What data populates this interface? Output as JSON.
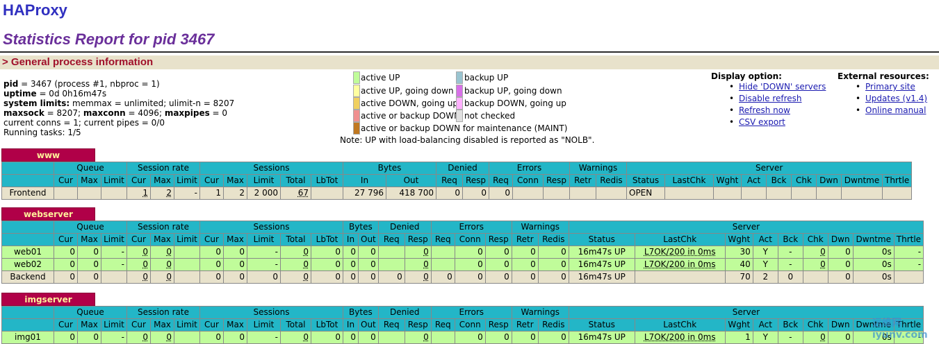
{
  "title": "HAProxy",
  "subtitle": "Statistics Report for pid 3467",
  "section": "> General process information",
  "info": {
    "pid_label": "pid",
    "pid_value": " = 3467 (process #1, nbproc = 1)",
    "uptime_label": "uptime",
    "uptime_value": " = 0d 0h16m47s",
    "limits_label": "system limits:",
    "limits_value": " memmax = unlimited; ulimit-n = 8207",
    "maxsock_label": "maxsock",
    "maxsock_value": " = 8207; ",
    "maxconn_label": "maxconn",
    "maxconn_value": " = 4096; ",
    "maxpipes_label": "maxpipes",
    "maxpipes_value": " = 0",
    "conns": "current conns = 1; current pipes = 0/0",
    "tasks": "Running tasks: 1/5"
  },
  "legend": {
    "active_up": "active UP",
    "active_up_going_down": "active UP, going down",
    "active_down_going_up": "active DOWN, going up",
    "active_or_backup_down": "active or backup DOWN",
    "maint": "active or backup DOWN for maintenance (MAINT)",
    "backup_up": "backup UP",
    "backup_up_going_down": "backup UP, going down",
    "backup_down_going_up": "backup DOWN, going up",
    "not_checked": "not checked",
    "colors": {
      "active_up": "#c0fc9a",
      "active_up_going_down": "#ffffa0",
      "active_down_going_up": "#f0d060",
      "active_or_backup_down": "#f09090",
      "maint": "#c07820",
      "backup_up": "#99c4d0",
      "backup_up_going_down": "#d870e8",
      "backup_down_going_up": "#ffb0ff",
      "not_checked": "#e0e0e0"
    }
  },
  "note": "Note: UP with load-balancing disabled is reported as \"NOLB\".",
  "display": {
    "heading": "Display option:",
    "items": [
      "Hide 'DOWN' servers",
      "Disable refresh",
      "Refresh now",
      "CSV export"
    ]
  },
  "external": {
    "heading": "External resources:",
    "items": [
      "Primary site",
      "Updates (v1.4)",
      "Online manual"
    ]
  },
  "groups": [
    "Queue",
    "Session rate",
    "Sessions",
    "Bytes",
    "Denied",
    "Errors",
    "Warnings",
    "Server"
  ],
  "cols": {
    "queue": [
      "Cur",
      "Max",
      "Limit"
    ],
    "rate": [
      "Cur",
      "Max",
      "Limit"
    ],
    "sessions": [
      "Cur",
      "Max",
      "Limit",
      "Total",
      "LbTot"
    ],
    "bytes": [
      "In",
      "Out"
    ],
    "denied": [
      "Req",
      "Resp"
    ],
    "errors": [
      "Req",
      "Conn",
      "Resp"
    ],
    "warnings": [
      "Retr",
      "Redis"
    ],
    "server": [
      "Status",
      "LastChk",
      "Wght",
      "Act",
      "Bck",
      "Chk",
      "Dwn",
      "Dwntme",
      "Thrtle"
    ]
  },
  "proxies": [
    {
      "name": "www",
      "rows": [
        {
          "kind": "fe",
          "cells": [
            "Frontend",
            "",
            "",
            "",
            "1",
            "2",
            "-",
            "1",
            "2",
            "2 000",
            "67",
            "",
            "27 796",
            "418 700",
            "0",
            "0",
            "0",
            "",
            "",
            "",
            "",
            "OPEN",
            "",
            "",
            "",
            "",
            "",
            "",
            "",
            ""
          ]
        }
      ]
    },
    {
      "name": "webserver",
      "rows": [
        {
          "kind": "sv",
          "cells": [
            "web01",
            "0",
            "0",
            "-",
            "0",
            "0",
            "",
            "0",
            "0",
            "-",
            "0",
            "0",
            "0",
            "0",
            "",
            "0",
            "",
            "0",
            "0",
            "0",
            "0",
            "16m47s UP",
            "L7OK/200 in 0ms",
            "30",
            "Y",
            "-",
            "0",
            "0",
            "0s",
            "-"
          ]
        },
        {
          "kind": "sv",
          "cells": [
            "web02",
            "0",
            "0",
            "-",
            "0",
            "0",
            "",
            "0",
            "0",
            "-",
            "0",
            "0",
            "0",
            "0",
            "",
            "0",
            "",
            "0",
            "0",
            "0",
            "0",
            "16m47s UP",
            "L7OK/200 in 0ms",
            "40",
            "Y",
            "-",
            "0",
            "0",
            "0s",
            "-"
          ]
        },
        {
          "kind": "be",
          "cells": [
            "Backend",
            "0",
            "0",
            "",
            "0",
            "0",
            "",
            "0",
            "0",
            "0",
            "0",
            "0",
            "0",
            "0",
            "0",
            "0",
            "0",
            "0",
            "0",
            "0",
            "0",
            "16m47s UP",
            "",
            "70",
            "2",
            "0",
            "",
            "0",
            "0s",
            ""
          ]
        }
      ]
    },
    {
      "name": "imgserver",
      "rows": [
        {
          "kind": "sv",
          "cells": [
            "img01",
            "0",
            "0",
            "-",
            "0",
            "0",
            "",
            "0",
            "0",
            "-",
            "0",
            "0",
            "0",
            "0",
            "",
            "0",
            "",
            "0",
            "0",
            "0",
            "0",
            "16m47s UP",
            "L7OK/200 in 0ms",
            "1",
            "Y",
            "-",
            "0",
            "0",
            "0s",
            "-"
          ]
        }
      ]
    }
  ],
  "watermark": "运维网 iyunv.com"
}
